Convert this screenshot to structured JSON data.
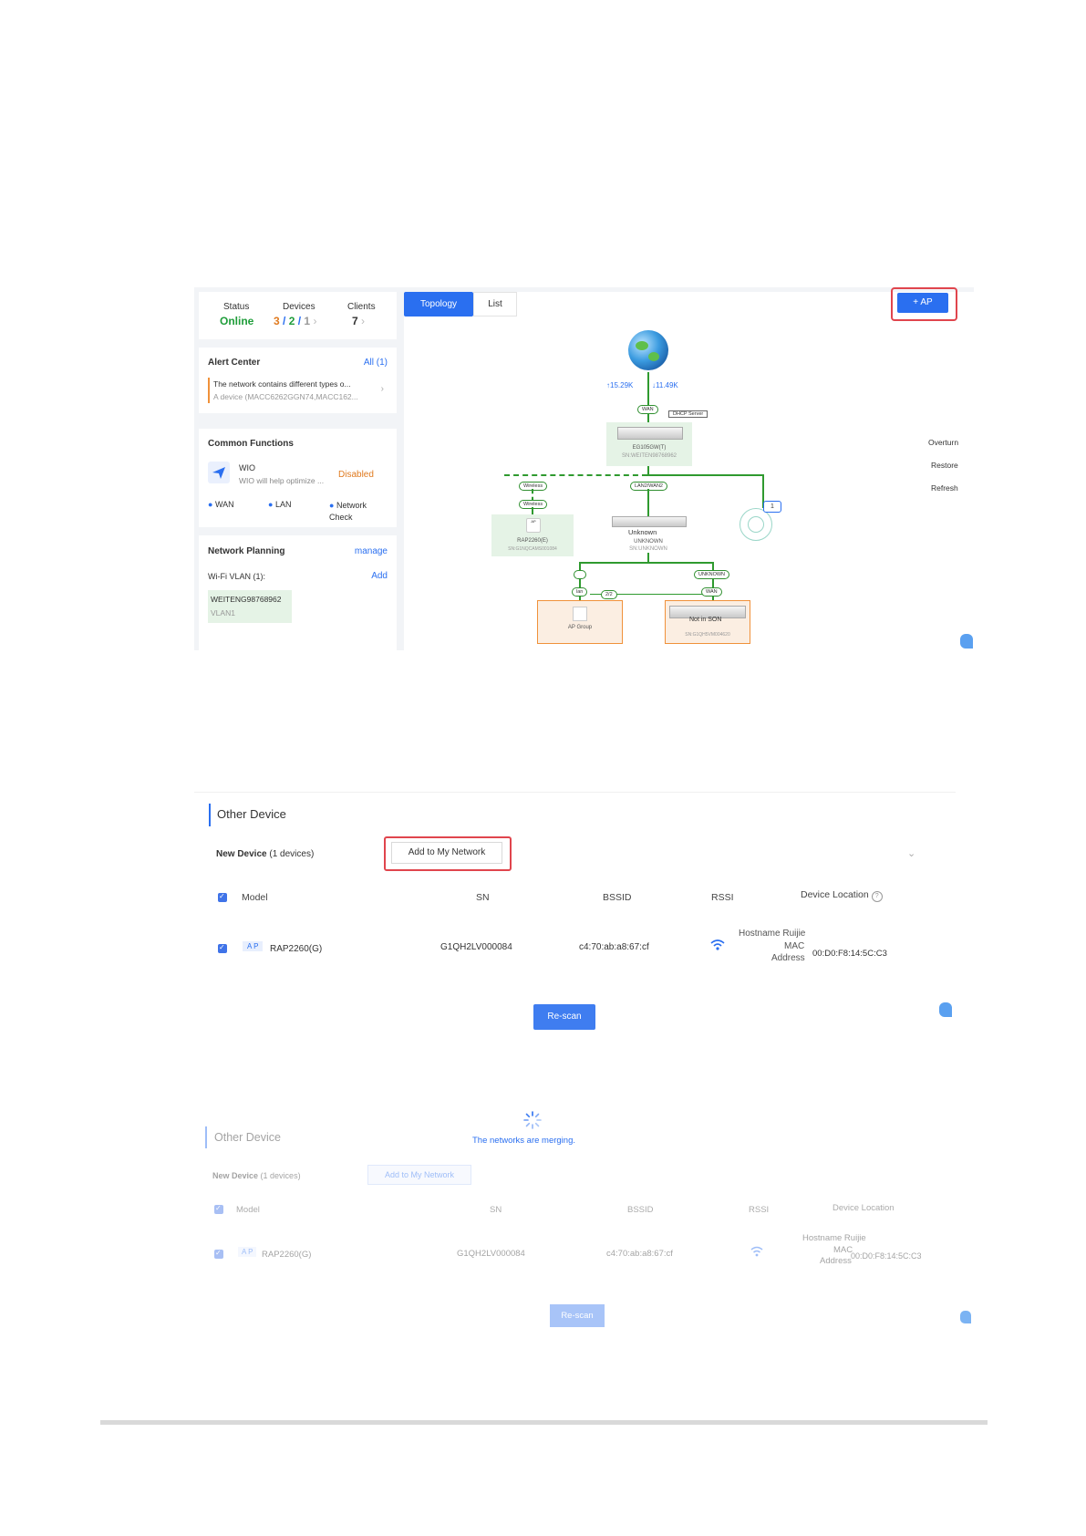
{
  "status": {
    "status_label": "Status",
    "status_value": "Online",
    "devices_label": "Devices",
    "dev_a": "3",
    "dev_b": "2",
    "dev_c": "1",
    "clients_label": "Clients",
    "clients_value": "7"
  },
  "alert": {
    "title": "Alert Center",
    "all": "All (1)",
    "line1": "The network contains different types o...",
    "line2": "A device (MACC6262GGN74,MACC162..."
  },
  "common": {
    "title": "Common Functions",
    "wio": "WIO",
    "wio_desc": "WIO will help optimize ...",
    "disabled": "Disabled",
    "wan": "WAN",
    "lan": "LAN",
    "netcheck_1": "Network",
    "netcheck_2": "Check"
  },
  "planning": {
    "title": "Network Planning",
    "manage": "manage",
    "wifi_vlan": "Wi-Fi VLAN (1):",
    "add": "Add",
    "ssid": "WEITENG98768962",
    "vlan": "VLAN1"
  },
  "tabs": {
    "topology": "Topology",
    "list": "List"
  },
  "ap_button": "+ AP",
  "side_actions": {
    "overturn": "Overturn",
    "restore": "Restore",
    "refresh": "Refresh"
  },
  "topology": {
    "up": "↑15.29K",
    "down": "↓11.49K",
    "wan": "WAN",
    "dhcp": "DHCP Server",
    "gw_model": "EG105GW(T)",
    "gw_sn": "SN:WEITEN98768962",
    "wireless1": "Wireless",
    "wireless2": "Wireless",
    "lan2wan2": "LAN2/WAN2",
    "rap_model": "RAP2260(E)",
    "rap_sn": "SN:G1NQCAMS001084",
    "rap_tag": "AP",
    "unknown": "Unknown",
    "unknown2": "UNKNOWN",
    "unknown_sn": "SN:UNKNOWN",
    "badge": "1",
    "unknown_tag": "UNKNOWN",
    "wan2": "WAN",
    "lan": "lan",
    "count": "2/2",
    "ap_group": "AP Group",
    "not_in_son": "Not in SON",
    "son_sn": "SN:G1QH5VM004620"
  },
  "other": {
    "title": "Other Device",
    "new_device": "New Device",
    "count": "(1 devices)",
    "add_btn": "Add to My Network",
    "headers": {
      "model": "Model",
      "sn": "SN",
      "bssid": "BSSID",
      "rssi": "RSSI",
      "location": "Device Location"
    },
    "row": {
      "tag": "A P",
      "model": "RAP2260(G)",
      "sn": "G1QH2LV000084",
      "bssid": "c4:70:ab:a8:67:cf",
      "hostname": "Hostname Ruijie",
      "mac_1": "MAC",
      "mac_2": "Address",
      "mac_value": "00:D0:F8:14:5C:C3"
    },
    "rescan": "Re-scan"
  },
  "merging": "The networks are merging.",
  "colors": {
    "accent": "#2a6ff0",
    "highlight": "#e0454d",
    "green": "#2f9a2f",
    "orange": "#f0913a"
  }
}
